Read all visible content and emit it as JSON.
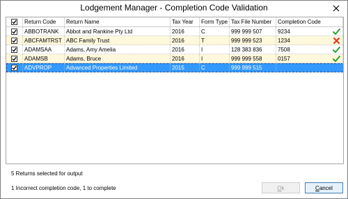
{
  "window": {
    "title": "Lodgement Manager - Completion Code Validation"
  },
  "grid": {
    "headers": {
      "return_code": "Return Code",
      "return_name": "Return Name",
      "tax_year": "Tax Year",
      "form_type": "Form Type",
      "tfn": "Tax File Number",
      "completion_code": "Completion Code"
    },
    "rows": [
      {
        "checked": true,
        "return_code": "ABBOTRANK",
        "return_name": "Abbot and Rankine Pty Ltd",
        "tax_year": "2016",
        "form_type": "C",
        "tfn": "999 999 507",
        "completion_code": "9234",
        "status": "valid"
      },
      {
        "checked": true,
        "return_code": "ABCFAMTRST",
        "return_name": "ABC Family Trust",
        "tax_year": "2016",
        "form_type": "T",
        "tfn": "999 999 523",
        "completion_code": "1234",
        "status": "invalid"
      },
      {
        "checked": true,
        "return_code": "ADAMSAA",
        "return_name": "Adams, Amy Amelia",
        "tax_year": "2016",
        "form_type": "I",
        "tfn": "128 383 836",
        "completion_code": "7508",
        "status": "valid"
      },
      {
        "checked": true,
        "return_code": "ADAMSB",
        "return_name": "Adams, Bruce",
        "tax_year": "2016",
        "form_type": "I",
        "tfn": "999 999 558",
        "completion_code": "0157",
        "status": "valid"
      },
      {
        "checked": true,
        "return_code": "ADVPROP",
        "return_name": "Advanced Properties Limited",
        "tax_year": "2015",
        "form_type": "C",
        "tfn": "999 999 515",
        "completion_code": "",
        "status": "none",
        "selected": true
      }
    ]
  },
  "footer": {
    "returns_selected": "5 Returns selected for output",
    "summary": "1 Incorrect completion code, 1 to complete"
  },
  "buttons": {
    "ok_prefix": "",
    "ok_underlined": "O",
    "ok_rest": "k",
    "cancel_prefix": "",
    "cancel_underlined": "C",
    "cancel_rest": "ancel"
  },
  "colors": {
    "selected_row": "#3399ff",
    "alt_row": "#fff8dc",
    "valid_icon": "#2aa12a",
    "invalid_icon": "#e03a1e"
  },
  "icons": {
    "close": "close-icon",
    "valid": "checkmark-icon",
    "invalid": "cross-icon"
  }
}
